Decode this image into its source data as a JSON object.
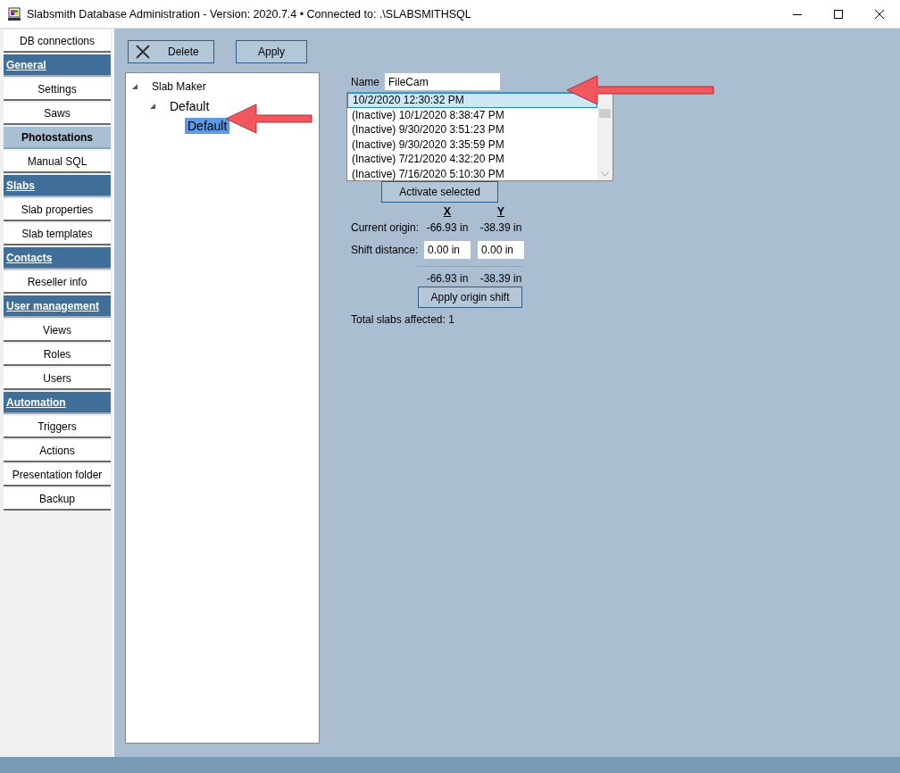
{
  "window": {
    "title": "Slabsmith Database Administration - Version: 2020.7.4 •  Connected to: .\\SLABSMITHSQL"
  },
  "sidebar": {
    "items": [
      {
        "kind": "item",
        "label": "DB connections",
        "selected": false
      },
      {
        "kind": "header",
        "label": "General",
        "selected": false
      },
      {
        "kind": "item",
        "label": "Settings",
        "selected": false
      },
      {
        "kind": "item",
        "label": "Saws",
        "selected": false
      },
      {
        "kind": "item",
        "label": "Photostations",
        "selected": true
      },
      {
        "kind": "item",
        "label": "Manual SQL",
        "selected": false
      },
      {
        "kind": "header",
        "label": "Slabs",
        "selected": false
      },
      {
        "kind": "item",
        "label": "Slab properties",
        "selected": false
      },
      {
        "kind": "item",
        "label": "Slab templates",
        "selected": false
      },
      {
        "kind": "header",
        "label": "Contacts",
        "selected": false
      },
      {
        "kind": "item",
        "label": "Reseller info",
        "selected": false
      },
      {
        "kind": "header",
        "label": "User management",
        "selected": false
      },
      {
        "kind": "item",
        "label": "Views",
        "selected": false
      },
      {
        "kind": "item",
        "label": "Roles",
        "selected": false
      },
      {
        "kind": "item",
        "label": "Users",
        "selected": false
      },
      {
        "kind": "header",
        "label": "Automation",
        "selected": false
      },
      {
        "kind": "item",
        "label": "Triggers",
        "selected": false
      },
      {
        "kind": "item",
        "label": "Actions",
        "selected": false
      },
      {
        "kind": "item",
        "label": "Presentation folder",
        "selected": false
      },
      {
        "kind": "item",
        "label": "Backup",
        "selected": false
      }
    ]
  },
  "toolbar": {
    "buttons": [
      {
        "kind": "delete",
        "label": "Delete"
      },
      {
        "kind": "plain",
        "label": "Apply"
      }
    ]
  },
  "tree": {
    "items": [
      {
        "label": "Slab Maker",
        "expanded": true,
        "selected": false,
        "children": [
          {
            "label": "Default",
            "expanded": true,
            "selected": false,
            "children": [
              {
                "label": "Default",
                "selected": true
              }
            ]
          }
        ]
      }
    ]
  },
  "form": {
    "name_label": "Name",
    "name_value": "FileCam",
    "versions": [
      {
        "label": "10/2/2020 12:30:32 PM",
        "selected": true
      },
      {
        "label": "(Inactive) 10/1/2020 8:38:47 PM",
        "selected": false
      },
      {
        "label": "(Inactive) 9/30/2020 3:51:23 PM",
        "selected": false
      },
      {
        "label": "(Inactive) 9/30/2020 3:35:59 PM",
        "selected": false
      },
      {
        "label": "(Inactive) 7/21/2020 4:32:20 PM",
        "selected": false
      },
      {
        "label": "(Inactive) 7/16/2020 5:10:30 PM",
        "selected": false
      }
    ],
    "activate_button": "Activate selected",
    "x_header": "X",
    "y_header": "Y",
    "current_origin_label": "Current origin:",
    "current_x": "-66.93 in",
    "current_y": "-38.39 in",
    "shift_label": "Shift distance:",
    "shift_x": "0.00 in",
    "shift_y": "0.00 in",
    "result_x": "-66.93 in",
    "result_y": "-38.39 in",
    "apply_shift_button": "Apply origin shift",
    "total_label": "Total slabs affected: 1"
  }
}
